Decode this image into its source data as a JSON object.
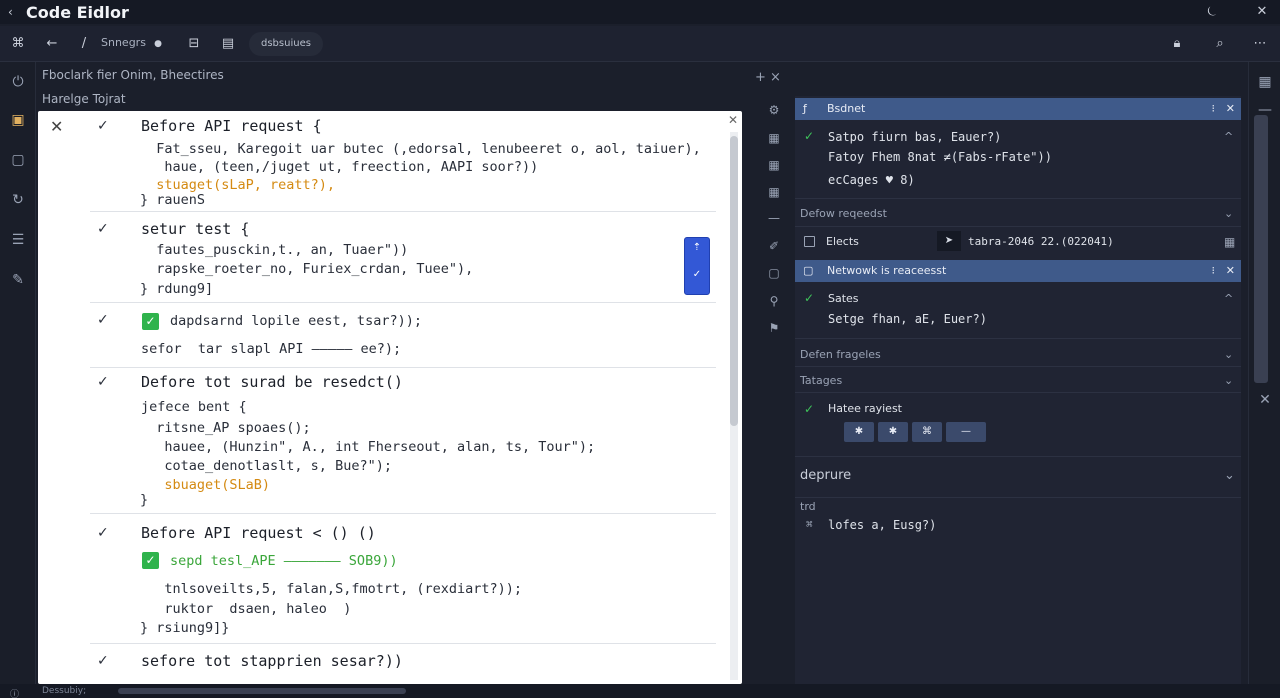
{
  "window": {
    "title": "Code Eidlor",
    "back_icon": "back-arrow-icon",
    "bell_icon": "bell-icon",
    "close_icon": "close-icon"
  },
  "toolbar": {
    "file_label": "Snnegrs",
    "tag_label": "dsbsuiues"
  },
  "breadcrumb": {
    "line1": "Fboclark fier  Onim, Bheectires",
    "line2": "Harelge Tojrat"
  },
  "editor": {
    "blocks": [
      {
        "head": "Before API request {",
        "lines": [
          "  Fat_sseu, Karegoit uar butec (,edorsal, lenubeeret o, aol, taiuer),",
          "   haue, (teen,/juget ut, freection, AAPI soor?))",
          "  stuaget(sLaP, reatt?),",
          "} rauenS"
        ]
      },
      {
        "head": "setur test {",
        "lines": [
          "  fautes_pusckin,t., an, Tuaer\"))",
          "  rapske_roeter_no, Furiex_crdan, Tuee\"),",
          "} rdung9]"
        ]
      },
      {
        "head": "dapdsarnd lopile eest, tsar?));",
        "lines": [
          "sefor  tar slapl API ————— ee?);"
        ]
      },
      {
        "head": "Defore tot surad be resedct()",
        "lines": [
          "jefece bent {",
          "  ritsne_AP spoaes();",
          "   hauee, (Hunzin\", A., int Fherseout, alan, ts, Tour\");",
          "   cotae_denotlaslt, s, Bue?\");",
          "   sbuaget(SLaB)",
          "}"
        ]
      },
      {
        "head": "Before API request < () ()",
        "lines": [
          "sepd tesl_APE ——————— SOB9))",
          "   tnlsoveilts,5, falan,S,fmotrt, (rexdiart?));",
          "   ruktor  dsaen, haleo  )",
          "} rsiung9]}"
        ]
      },
      {
        "head": "sefore tot stapprien sesar?))",
        "lines": []
      }
    ]
  },
  "right_panel": {
    "bar1": "Bsdnet",
    "rows1": [
      "Satpo fiurn bas, Eauer?)",
      "Fatoy Fhem 8nat ≠(Fabs-rFate\"))",
      "ecCages ♥ 8)"
    ],
    "section1": "Defow reqeedst",
    "elects_label": "Elects",
    "timestamp": "tabra-2046 22.(022041)",
    "bar2": "Netwowk is reaceesst",
    "sates_label": "Sates",
    "sates_value": "Setge fhan, aE, Euer?)",
    "section2": "Defen frageles",
    "section3": "Tatages",
    "hatte_label": "Hatee rayiest",
    "mini_buttons": [
      "✱",
      "✱",
      "⌘",
      "—"
    ],
    "section4": "deprure",
    "section5_label": "trd",
    "section5_value": "lofes a, Eusg?)"
  },
  "status": {
    "bottom_text": "Dessubiy;"
  }
}
